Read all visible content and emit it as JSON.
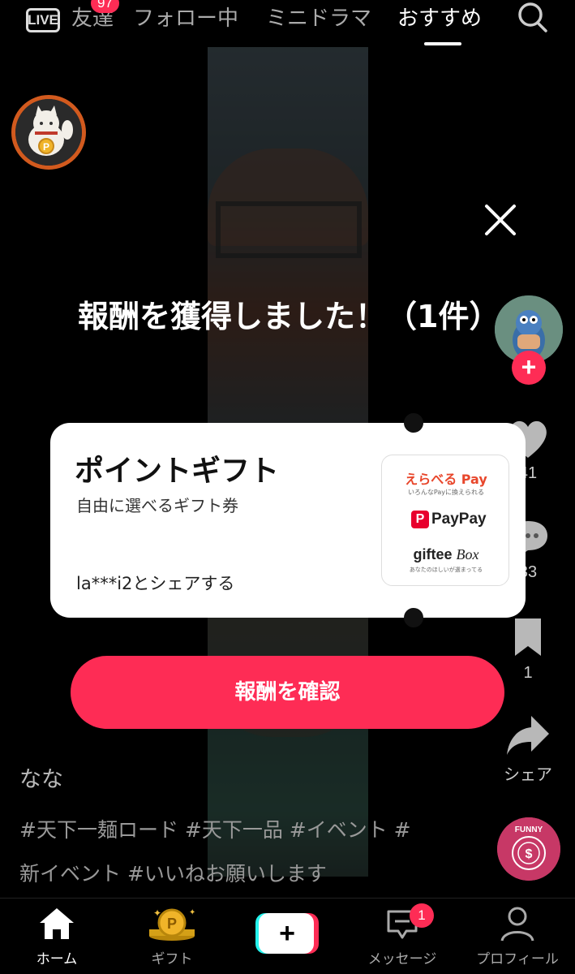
{
  "top_nav": {
    "live_label": "LIVE",
    "badge_count": "97",
    "tabs": [
      {
        "label": "友達"
      },
      {
        "label": "フォロー中"
      },
      {
        "label": "ミニドラマ"
      },
      {
        "label": "おすすめ"
      }
    ],
    "active_tab": "おすすめ"
  },
  "reward_modal": {
    "title": "報酬を獲得しました！（1件）",
    "card": {
      "title": "ポイントギフト",
      "subtitle": "自由に選べるギフト券",
      "share_text": "la***i2とシェアする",
      "logos": {
        "erabu_pay": "えらべる Pay",
        "erabu_pay_tagline": "いろんなPayに換えられる",
        "paypay": "PayPay",
        "paypay_icon": "P",
        "giftee": "giftee",
        "giftee_box": "Box",
        "giftee_tagline": "あなたのほしいが選まってる"
      }
    },
    "confirm_label": "報酬を確認"
  },
  "right_rail": {
    "like_count": "41",
    "comment_count": "33",
    "bookmark_count": "1",
    "share_label": "シェア",
    "follow_icon": "+"
  },
  "caption": {
    "username": "なな",
    "hashtags": "#天下一麺ロード #天下一品 #イベント #新イベント #いいねお願いします"
  },
  "bottom_nav": {
    "items": [
      {
        "label": "ホーム",
        "icon": "home-icon"
      },
      {
        "label": "ギフト",
        "icon": "gift-points-icon"
      },
      {
        "label": "",
        "icon": "create-plus-icon"
      },
      {
        "label": "メッセージ",
        "icon": "message-icon"
      },
      {
        "label": "プロフィール",
        "icon": "profile-icon"
      }
    ],
    "message_badge": "1",
    "plus_symbol": "+"
  },
  "colors": {
    "accent": "#fe2c55",
    "reward_ring": "#d25a1e",
    "erabu_red": "#e8472c",
    "paypay_red": "#e8002d"
  }
}
